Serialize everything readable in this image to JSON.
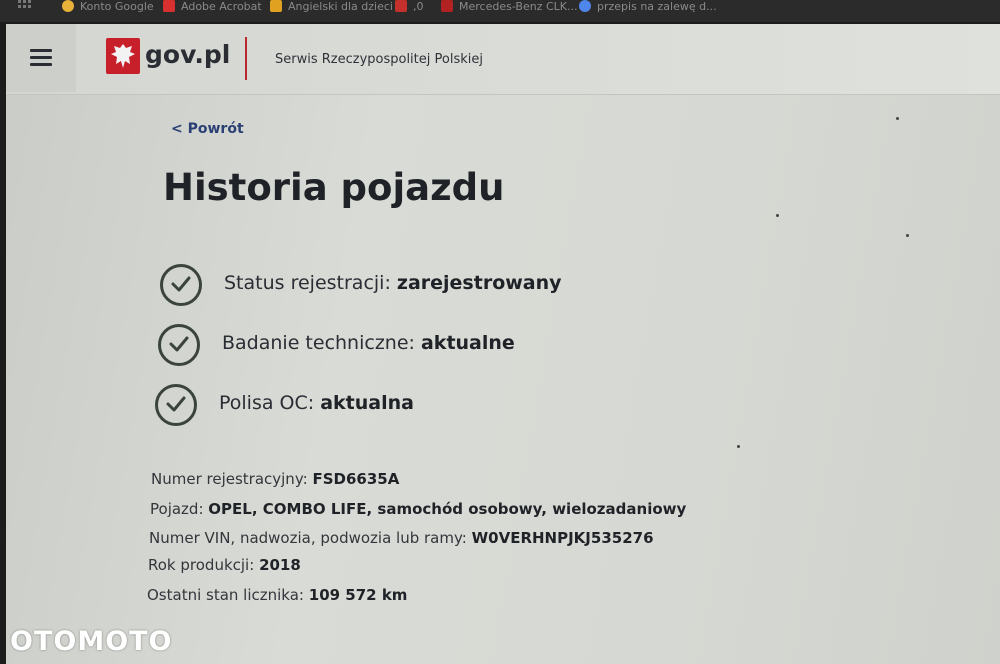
{
  "bookmarks": [
    {
      "label": "Konto Google",
      "icon": "google-icon",
      "color": "#e8b13a"
    },
    {
      "label": "Adobe Acrobat",
      "icon": "acrobat-icon",
      "color": "#d8312f"
    },
    {
      "label": "Angielski dla dzieci",
      "icon": "play-icon",
      "color": "#e0a020"
    },
    {
      "label": ",0",
      "icon": "red-icon",
      "color": "#c4302b"
    },
    {
      "label": "Mercedes-Benz CLK...",
      "icon": "red-icon",
      "color": "#b22222"
    },
    {
      "label": "przepis na zalewę d...",
      "icon": "google-icon",
      "color": "#4f86ec"
    }
  ],
  "header": {
    "logo_text": "gov.pl",
    "service_name": "Serwis Rzeczypospolitej Polskiej"
  },
  "back_link": "< Powrót",
  "title": "Historia pojazdu",
  "statuses": [
    {
      "label": "Status rejestracji:",
      "value": "zarejestrowany"
    },
    {
      "label": "Badanie techniczne:",
      "value": "aktualne"
    },
    {
      "label": "Polisa OC:",
      "value": "aktualna"
    }
  ],
  "details": [
    {
      "label": "Numer rejestracyjny:",
      "value": "FSD6635A"
    },
    {
      "label": "Pojazd:",
      "value": "OPEL, COMBO LIFE, samochód osobowy, wielozadaniowy"
    },
    {
      "label": "Numer VIN, nadwozia, podwozia lub ramy:",
      "value": "W0VERHNPJKJ535276"
    },
    {
      "label": "Rok produkcji:",
      "value": "2018"
    },
    {
      "label": "Ostatni stan licznika:",
      "value": "109 572 km"
    }
  ],
  "watermark": "OTOMOTO",
  "colors": {
    "brand_red": "#c8202a",
    "link_blue": "#2a3f74",
    "check_green": "#3b433e"
  }
}
